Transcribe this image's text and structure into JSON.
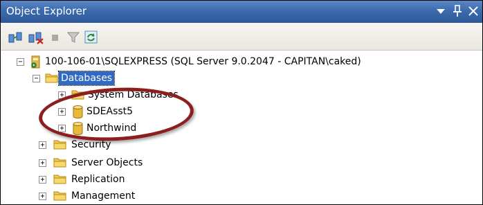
{
  "window": {
    "title": "Object Explorer",
    "controls": [
      "chevron-down-icon",
      "pin-icon",
      "close-icon"
    ]
  },
  "toolbar": {
    "buttons": [
      {
        "icon": "connect-icon"
      },
      {
        "icon": "disconnect-icon"
      },
      {
        "icon": "stop-icon"
      },
      {
        "icon": "filter-icon"
      },
      {
        "icon": "refresh-icon"
      }
    ]
  },
  "tree": {
    "server": "100-106-01\\SQLEXPRESS (SQL Server 9.0.2047 - CAPITAN\\caked)",
    "databases": {
      "label": "Databases",
      "children": [
        {
          "label": "System Databases",
          "icon": "folder-icon"
        },
        {
          "label": "SDEAsst5",
          "icon": "database-icon"
        },
        {
          "label": "Northwind",
          "icon": "database-icon"
        }
      ]
    },
    "folders": [
      {
        "label": "Security"
      },
      {
        "label": "Server Objects"
      },
      {
        "label": "Replication"
      },
      {
        "label": "Management"
      }
    ]
  },
  "colors": {
    "titlebar": "#3b6aae",
    "selection": "#316ac5",
    "annotation": "#8d1e1e",
    "folder": "#f2c94c"
  }
}
